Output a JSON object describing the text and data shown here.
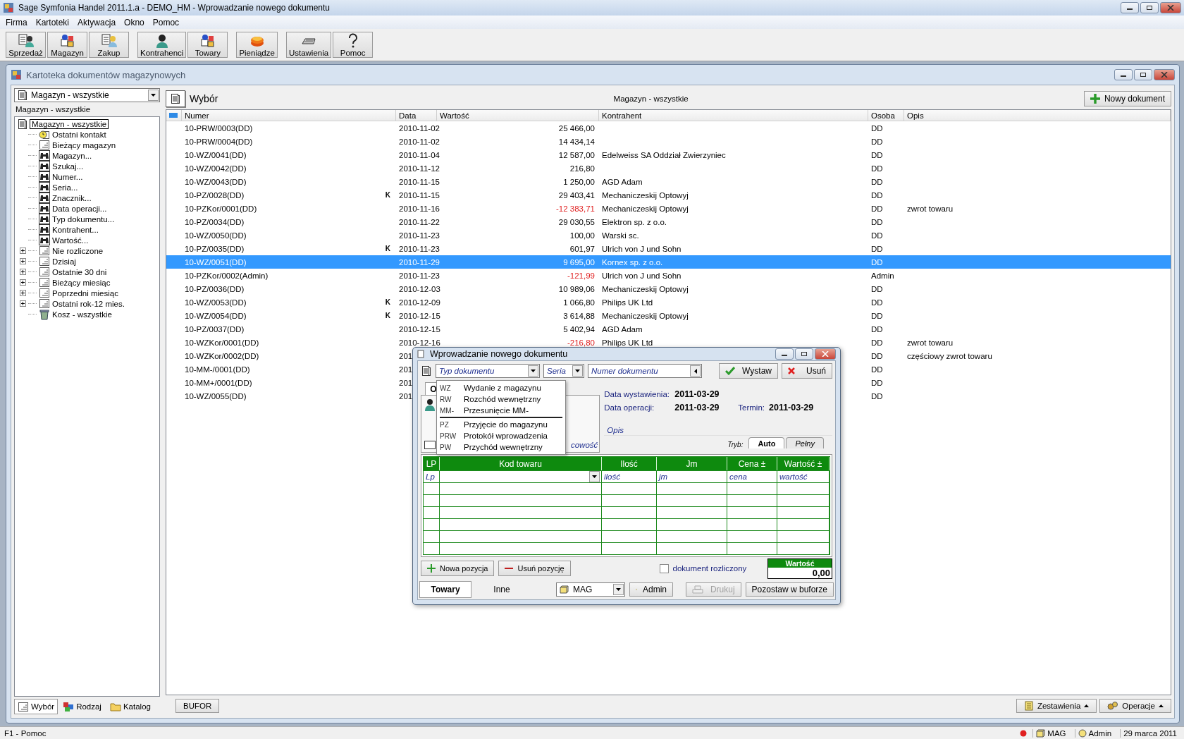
{
  "window": {
    "title": "Sage Symfonia Handel 2011.1.a - DEMO_HM - Wprowadzanie nowego dokumentu"
  },
  "menu": [
    "Firma",
    "Kartoteki",
    "Aktywacja",
    "Okno",
    "Pomoc"
  ],
  "toolbar": [
    [
      {
        "label": "Sprzedaż",
        "kind": "sales"
      },
      {
        "label": "Magazyn",
        "kind": "goods"
      },
      {
        "label": "Zakup",
        "kind": "purchase"
      }
    ],
    [
      {
        "label": "Kontrahenci",
        "kind": "customer"
      },
      {
        "label": "Towary",
        "kind": "goods"
      }
    ],
    [
      {
        "label": "Pieniądze",
        "kind": "money"
      }
    ],
    [
      {
        "label": "Ustawienia",
        "kind": "settings"
      },
      {
        "label": "Pomoc",
        "kind": "help"
      }
    ]
  ],
  "child_window": {
    "title": "Kartoteka dokumentów magazynowych",
    "left_panel": {
      "combo": "Magazyn - wszystkie",
      "caption": "Magazyn - wszystkie",
      "tree": {
        "label": "Magazyn - wszystkie",
        "selected": true,
        "children": [
          {
            "label": "Ostatni kontakt",
            "kind": "recent",
            "collapsed": false
          },
          {
            "label": "Bieżący magazyn",
            "kind": "list",
            "collapsed": false
          },
          {
            "label": "Magazyn...",
            "kind": "search",
            "collapsed": false
          },
          {
            "label": "Szukaj...",
            "kind": "search",
            "collapsed": false
          },
          {
            "label": "Numer...",
            "kind": "search",
            "collapsed": false
          },
          {
            "label": "Seria...",
            "kind": "search",
            "collapsed": false
          },
          {
            "label": "Znacznik...",
            "kind": "search",
            "collapsed": false
          },
          {
            "label": "Data operacji...",
            "kind": "search",
            "collapsed": false
          },
          {
            "label": "Typ dokumentu...",
            "kind": "search",
            "collapsed": false
          },
          {
            "label": "Kontrahent...",
            "kind": "search",
            "collapsed": false
          },
          {
            "label": "Wartość...",
            "kind": "search",
            "collapsed": false
          },
          {
            "label": "Nie rozliczone",
            "kind": "list",
            "collapsed": true
          },
          {
            "label": "Dzisiaj",
            "kind": "list",
            "collapsed": true
          },
          {
            "label": "Ostatnie 30 dni",
            "kind": "list",
            "collapsed": true
          },
          {
            "label": "Bieżący miesiąc",
            "kind": "list",
            "collapsed": true
          },
          {
            "label": "Poprzedni miesiąc",
            "kind": "list",
            "collapsed": true
          },
          {
            "label": "Ostatni rok-12 mies.",
            "kind": "list",
            "collapsed": true
          },
          {
            "label": "Kosz - wszystkie",
            "kind": "trash",
            "collapsed": false
          }
        ]
      },
      "tabs": [
        {
          "label": "Wybór",
          "kind": "list",
          "selected": true
        },
        {
          "label": "Rodzaj",
          "kind": "types",
          "selected": false
        },
        {
          "label": "Katalog",
          "kind": "folder",
          "selected": false
        }
      ]
    },
    "right_panel": {
      "title": "Wybór",
      "filter": "Magazyn - wszystkie",
      "new_button": "Nowy dokument",
      "table": {
        "columns": [
          "Numer",
          "Data",
          "Wartość",
          "Kontrahent",
          "Osoba",
          "Opis"
        ],
        "rows": [
          {
            "numer": "10-PRW/0003(DD)",
            "data": "2010-11-02",
            "wartosc": "25 466,00",
            "negative": false,
            "osoba": "DD",
            "selected": false
          },
          {
            "numer": "10-PRW/0004(DD)",
            "data": "2010-11-02",
            "wartosc": "14 434,14",
            "negative": false,
            "osoba": "DD",
            "selected": false
          },
          {
            "numer": "10-WZ/0041(DD)",
            "data": "2010-11-04",
            "wartosc": "12 587,00",
            "negative": false,
            "kontrahent": "Edelweiss SA Oddział Zwierzyniec",
            "osoba": "DD",
            "selected": false
          },
          {
            "numer": "10-WZ/0042(DD)",
            "data": "2010-11-12",
            "wartosc": "216,80",
            "negative": false,
            "osoba": "DD",
            "selected": false
          },
          {
            "numer": "10-WZ/0043(DD)",
            "data": "2010-11-15",
            "wartosc": "1 250,00",
            "negative": false,
            "kontrahent": "AGD Adam",
            "osoba": "DD",
            "selected": false
          },
          {
            "numer": "10-PZ/0028(DD)",
            "flag": "K",
            "data": "2010-11-15",
            "wartosc": "29 403,41",
            "negative": false,
            "kontrahent": "Mechaniczeskij Optowyj",
            "osoba": "DD",
            "selected": false
          },
          {
            "numer": "10-PZKor/0001(DD)",
            "data": "2010-11-16",
            "wartosc": "-12 383,71",
            "negative": true,
            "kontrahent": "Mechaniczeskij Optowyj",
            "osoba": "DD",
            "opis": "zwrot towaru",
            "selected": false
          },
          {
            "numer": "10-PZ/0034(DD)",
            "data": "2010-11-22",
            "wartosc": "29 030,55",
            "negative": false,
            "kontrahent": "Elektron sp. z o.o.",
            "osoba": "DD",
            "selected": false
          },
          {
            "numer": "10-WZ/0050(DD)",
            "data": "2010-11-23",
            "wartosc": "100,00",
            "negative": false,
            "kontrahent": "Warski sc.",
            "osoba": "DD",
            "selected": false
          },
          {
            "numer": "10-PZ/0035(DD)",
            "flag": "K",
            "data": "2010-11-23",
            "wartosc": "601,97",
            "negative": false,
            "kontrahent": "Ulrich von J und Sohn",
            "osoba": "DD",
            "selected": false
          },
          {
            "numer": "10-WZ/0051(DD)",
            "data": "2010-11-29",
            "wartosc": "9 695,00",
            "negative": false,
            "kontrahent": "Kornex sp. z o.o.",
            "osoba": "DD",
            "selected": true
          },
          {
            "numer": "10-PZKor/0002(Admin)",
            "data": "2010-11-23",
            "wartosc": "-121,99",
            "negative": true,
            "kontrahent": "Ulrich von J und Sohn",
            "osoba": "Admin",
            "selected": false
          },
          {
            "numer": "10-PZ/0036(DD)",
            "data": "2010-12-03",
            "wartosc": "10 989,06",
            "negative": false,
            "kontrahent": "Mechaniczeskij Optowyj",
            "osoba": "DD",
            "selected": false
          },
          {
            "numer": "10-WZ/0053(DD)",
            "flag": "K",
            "data": "2010-12-09",
            "wartosc": "1 066,80",
            "negative": false,
            "kontrahent": "Philips UK Ltd",
            "osoba": "DD",
            "selected": false
          },
          {
            "numer": "10-WZ/0054(DD)",
            "flag": "K",
            "data": "2010-12-15",
            "wartosc": "3 614,88",
            "negative": false,
            "kontrahent": "Mechaniczeskij Optowyj",
            "osoba": "DD",
            "selected": false
          },
          {
            "numer": "10-PZ/0037(DD)",
            "data": "2010-12-15",
            "wartosc": "5 402,94",
            "negative": false,
            "kontrahent": "AGD Adam",
            "osoba": "DD",
            "selected": false
          },
          {
            "numer": "10-WZKor/0001(DD)",
            "data": "2010-12-16",
            "wartosc": "-216,80",
            "negative": true,
            "kontrahent": "Philips UK Ltd",
            "osoba": "DD",
            "opis": "zwrot towaru",
            "selected": false
          },
          {
            "numer": "10-WZKor/0002(DD)",
            "data": "201",
            "osoba": "DD",
            "opis": "częściowy zwrot towaru",
            "selected": false
          },
          {
            "numer": "10-MM-/0001(DD)",
            "data": "201",
            "osoba": "DD",
            "selected": false
          },
          {
            "numer": "10-MM+/0001(DD)",
            "data": "201",
            "osoba": "DD",
            "selected": false
          },
          {
            "numer": "10-WZ/0055(DD)",
            "data": "201",
            "osoba": "DD",
            "selected": false
          }
        ]
      },
      "buffer_button": "BUFOR",
      "buttons": [
        {
          "label": "Zestawienia",
          "kind": "report"
        },
        {
          "label": "Operacje",
          "kind": "gears"
        }
      ]
    }
  },
  "dialog": {
    "title": "Wprowadzanie nowego dokumentu",
    "type_field": {
      "placeholder": "Typ dokumentu"
    },
    "series_field": {
      "placeholder": "Seria"
    },
    "number_field": {
      "placeholder": "Numer dokumentu"
    },
    "issue_button": "Wystaw",
    "delete_button": "Usuń",
    "type_menu": [
      [
        {
          "code": "WZ",
          "label": "Wydanie z magazynu"
        },
        {
          "code": "RW",
          "label": "Rozchód wewnętrzny"
        },
        {
          "code": "MM-",
          "label": "Przesunięcie MM-"
        }
      ],
      [
        {
          "code": "PZ",
          "label": "Przyjęcie do magazynu"
        },
        {
          "code": "PRW",
          "label": "Protokół wprowadzenia"
        },
        {
          "code": "PW",
          "label": "Przychód wewnętrzny"
        }
      ]
    ],
    "party_tab": "O",
    "party_city": {
      "placeholder": "cowość"
    },
    "dates": [
      {
        "label": "Data wystawienia:",
        "value": "2011-03-29"
      },
      {
        "label": "Data operacji:",
        "value": "2011-03-29"
      }
    ],
    "due": {
      "label": "Termin:",
      "value": "2011-03-29"
    },
    "description": {
      "placeholder": "Opis"
    },
    "mode": {
      "label": "Tryb:",
      "tabs": [
        {
          "label": "Auto",
          "selected": true
        },
        {
          "label": "Pełny",
          "selected": false
        }
      ]
    },
    "grid": {
      "columns": [
        "LP",
        "Kod towaru",
        "Ilość",
        "Jm",
        "Cena ±",
        "Wartość ±"
      ],
      "edit_row": [
        {
          "kind": "text",
          "placeholder": "Lp"
        },
        {
          "kind": "combo"
        },
        {
          "kind": "text",
          "placeholder": "ilość"
        },
        {
          "kind": "text",
          "placeholder": "jm"
        },
        {
          "kind": "text",
          "placeholder": "cena"
        },
        {
          "kind": "text",
          "placeholder": "wartość"
        }
      ]
    },
    "add_button": "Nowa pozycja",
    "remove_button": "Usuń pozycję",
    "settled": {
      "label": "dokument rozliczony",
      "checked": false
    },
    "total": {
      "label": "Wartość",
      "value": "0,00"
    },
    "bottom_tabs": [
      {
        "label": "Towary",
        "selected": true
      },
      {
        "label": "Inne",
        "selected": false
      }
    ],
    "warehouse": "MAG",
    "user": "Admin",
    "print_button": {
      "label": "Drukuj",
      "disabled": true
    },
    "buffer_button": "Pozostaw w buforze"
  },
  "status_bar": {
    "help": "F1 - Pomoc",
    "warehouse": "MAG",
    "user": "Admin",
    "date": "29 marca 2011"
  }
}
